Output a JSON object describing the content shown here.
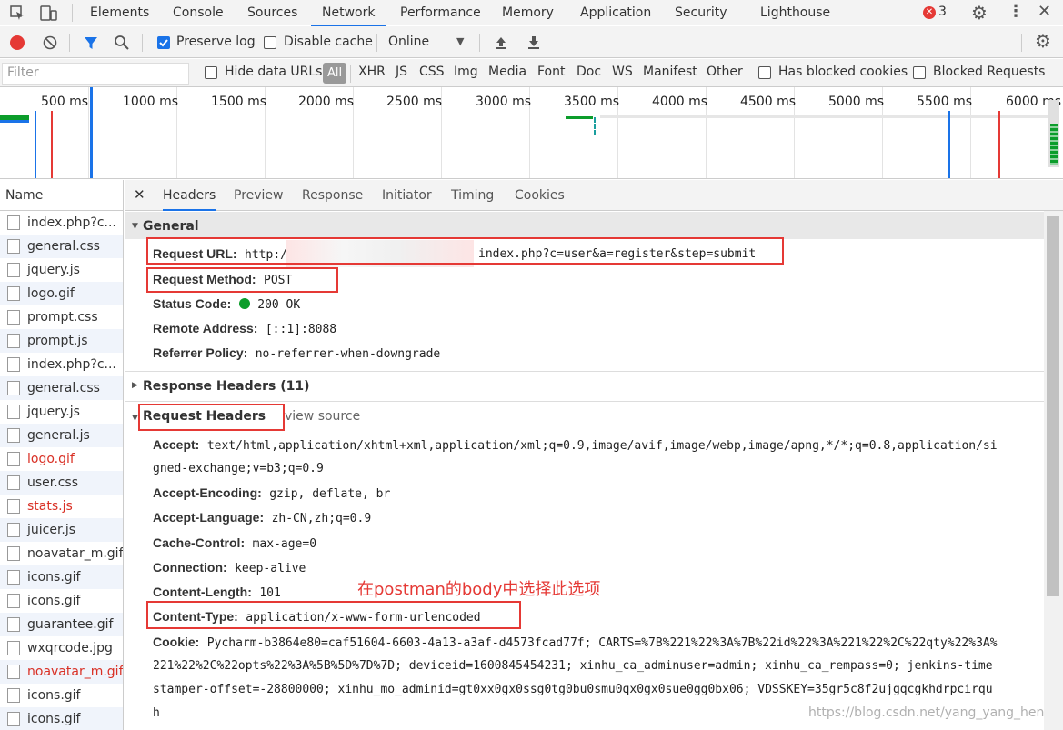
{
  "tabs": [
    "Elements",
    "Console",
    "Sources",
    "Network",
    "Performance",
    "Memory",
    "Application",
    "Security",
    "Lighthouse"
  ],
  "error_count": "3",
  "toolbar": {
    "preserve_log": "Preserve log",
    "disable_cache": "Disable cache",
    "throttle": "Online"
  },
  "filter": {
    "placeholder": "Filter",
    "hide_data_urls": "Hide data URLs",
    "all": "All",
    "types": [
      "XHR",
      "JS",
      "CSS",
      "Img",
      "Media",
      "Font",
      "Doc",
      "WS",
      "Manifest",
      "Other"
    ],
    "blocked_cookies": "Has blocked cookies",
    "blocked_requests": "Blocked Requests"
  },
  "timeline_ticks": [
    "500 ms",
    "1000 ms",
    "1500 ms",
    "2000 ms",
    "2500 ms",
    "3000 ms",
    "3500 ms",
    "4000 ms",
    "4500 ms",
    "5000 ms",
    "5500 ms",
    "6000 ms"
  ],
  "name_header": "Name",
  "files": [
    {
      "name": "index.php?c...",
      "red": false
    },
    {
      "name": "general.css",
      "red": false
    },
    {
      "name": "jquery.js",
      "red": false
    },
    {
      "name": "logo.gif",
      "red": false
    },
    {
      "name": "prompt.css",
      "red": false
    },
    {
      "name": "prompt.js",
      "red": false
    },
    {
      "name": "index.php?c...",
      "red": false
    },
    {
      "name": "general.css",
      "red": false
    },
    {
      "name": "jquery.js",
      "red": false
    },
    {
      "name": "general.js",
      "red": false
    },
    {
      "name": "logo.gif",
      "red": true
    },
    {
      "name": "user.css",
      "red": false
    },
    {
      "name": "stats.js",
      "red": true
    },
    {
      "name": "juicer.js",
      "red": false
    },
    {
      "name": "noavatar_m.gif",
      "red": false
    },
    {
      "name": "icons.gif",
      "red": false
    },
    {
      "name": "icons.gif",
      "red": false
    },
    {
      "name": "guarantee.gif",
      "red": false
    },
    {
      "name": "wxqrcode.jpg",
      "red": false
    },
    {
      "name": "noavatar_m.gif",
      "red": true
    },
    {
      "name": "icons.gif",
      "red": false
    },
    {
      "name": "icons.gif",
      "red": false
    }
  ],
  "detail_tabs": [
    "Headers",
    "Preview",
    "Response",
    "Initiator",
    "Timing",
    "Cookies"
  ],
  "general": {
    "title": "General",
    "request_url_key": "Request URL:",
    "request_url_a": "http:/",
    "request_url_b": "index.php?c=user&a=register&step=submit",
    "method_key": "Request Method:",
    "method_val": "POST",
    "status_key": "Status Code:",
    "status_val": "200 OK",
    "remote_key": "Remote Address:",
    "remote_val": "[::1]:8088",
    "referrer_key": "Referrer Policy:",
    "referrer_val": "no-referrer-when-downgrade"
  },
  "response_headers": "Response Headers (11)",
  "request_headers": "Request Headers",
  "view_source": "view source",
  "headers": {
    "accept_key": "Accept:",
    "accept_val1": "text/html,application/xhtml+xml,application/xml;q=0.9,image/avif,image/webp,image/apng,*/*;q=0.8,application/si",
    "accept_val2": "gned-exchange;v=b3;q=0.9",
    "enc_key": "Accept-Encoding:",
    "enc_val": "gzip, deflate, br",
    "lang_key": "Accept-Language:",
    "lang_val": "zh-CN,zh;q=0.9",
    "cache_key": "Cache-Control:",
    "cache_val": "max-age=0",
    "conn_key": "Connection:",
    "conn_val": "keep-alive",
    "len_key": "Content-Length:",
    "len_val": "101",
    "ct_key": "Content-Type:",
    "ct_val": "application/x-www-form-urlencoded",
    "cookie_key": "Cookie:",
    "cookie_val1": "Pycharm-b3864e80=caf51604-6603-4a13-a3af-d4573fcad77f; CARTS=%7B%221%22%3A%7B%22id%22%3A%221%22%2C%22qty%22%3A%",
    "cookie_val2": "221%22%2C%22opts%22%3A%5B%5D%7D%7D; deviceid=1600845454231; xinhu_ca_adminuser=admin; xinhu_ca_rempass=0; jenkins-time",
    "cookie_val3": "stamper-offset=-28800000; xinhu_mo_adminid=gt0xx0gx0ssg0tg0bu0smu0qx0gx0sue0gg0bx06; VDSSKEY=35gr5c8f2ujgqcgkhdrpcirqu",
    "cookie_val4": "h"
  },
  "annotation": "在postman的body中选择此选项",
  "watermark": "https://blog.csdn.net/yang_yang_heng",
  "colors": {
    "accent": "#1a73e8",
    "annotation": "#e53935",
    "status_ok": "#0c9d2b"
  }
}
